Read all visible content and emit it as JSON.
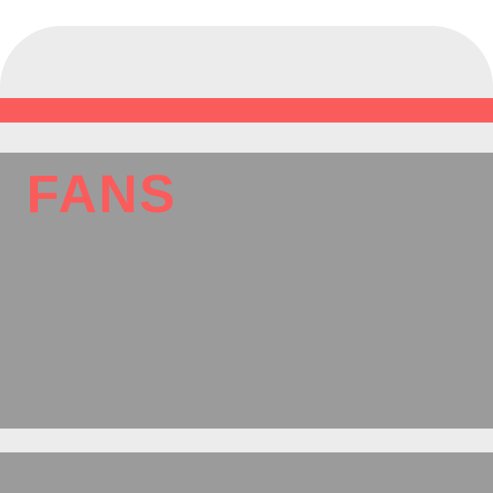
{
  "panel": {
    "title": "FANS"
  },
  "colors": {
    "accent": "#fa5c5c",
    "surface": "#ececed",
    "panel": "#9b9b9b",
    "background": "#ffffff"
  }
}
